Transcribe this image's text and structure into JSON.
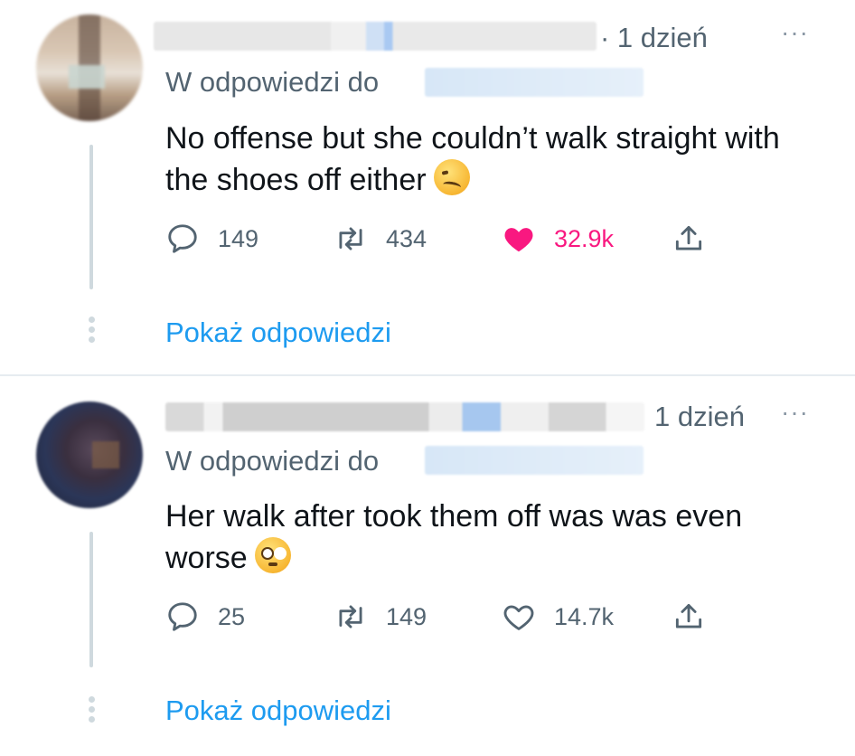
{
  "colors": {
    "accent": "#1d9bf0",
    "like": "#f91880",
    "muted": "#536471"
  },
  "replies": [
    {
      "time": "· 1 dzień",
      "menu": "···",
      "reply_to_label": "W odpowiedzi do",
      "text": "No offense but she couldn’t walk straight with the shoes off either",
      "emoji": "woozy-face",
      "reply_count": "149",
      "retweet_count": "434",
      "like_count": "32.9k",
      "liked": true,
      "show_replies": "Pokaż odpowiedzi"
    },
    {
      "time": "1 dzień",
      "menu": "···",
      "reply_to_label": "W odpowiedzi do",
      "text": "Her walk after took them off was was even worse",
      "emoji": "flushed-face",
      "reply_count": "25",
      "retweet_count": "149",
      "like_count": "14.7k",
      "liked": false,
      "show_replies": "Pokaż odpowiedzi"
    }
  ]
}
